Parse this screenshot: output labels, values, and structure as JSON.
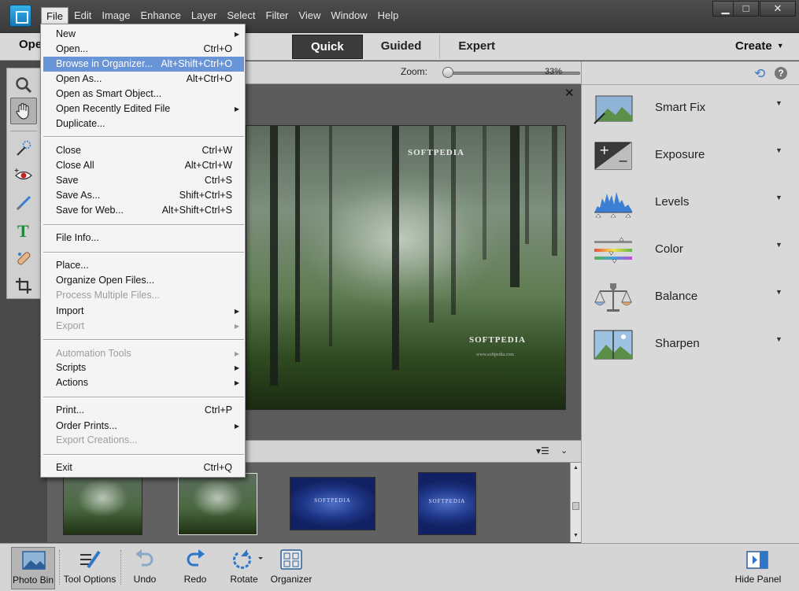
{
  "menubar": {
    "items": [
      "File",
      "Edit",
      "Image",
      "Enhance",
      "Layer",
      "Select",
      "Filter",
      "View",
      "Window",
      "Help"
    ]
  },
  "window_controls": {
    "minimize": "▁",
    "maximize": "□",
    "close": "✕"
  },
  "modebar": {
    "open_label": "Ope",
    "tabs": [
      "Quick",
      "Guided",
      "Expert"
    ],
    "active_tab": "Quick",
    "create_label": "Create"
  },
  "zoom": {
    "label": "Zoom:",
    "value": "33%",
    "level_percent": 33
  },
  "canvas": {
    "close_glyph": "✕",
    "photo_caption": "SOFTPEDIA",
    "photo_caption2": "SOFTPEDIA",
    "photo_subcaption": "www.softpedia.com"
  },
  "thumbnails": [
    {
      "kind": "forest",
      "caption": ""
    },
    {
      "kind": "forest",
      "caption": ""
    },
    {
      "kind": "blue",
      "caption": "SOFTPEDIA"
    },
    {
      "kind": "blue",
      "caption": "SOFTPEDIA"
    }
  ],
  "right_panel": {
    "adjustments": [
      {
        "label": "Smart Fix",
        "icon": "smart-fix-icon"
      },
      {
        "label": "Exposure",
        "icon": "exposure-icon"
      },
      {
        "label": "Levels",
        "icon": "levels-icon"
      },
      {
        "label": "Color",
        "icon": "color-icon"
      },
      {
        "label": "Balance",
        "icon": "balance-icon"
      },
      {
        "label": "Sharpen",
        "icon": "sharpen-icon"
      }
    ]
  },
  "bottombar": {
    "photo_bin": "Photo Bin",
    "tool_options": "Tool Options",
    "undo": "Undo",
    "redo": "Redo",
    "rotate": "Rotate",
    "organizer": "Organizer",
    "hide_panel": "Hide Panel"
  },
  "file_menu": {
    "items": [
      {
        "label": "New",
        "shortcut": "",
        "arrow": true,
        "disabled": false,
        "highlighted": false
      },
      {
        "label": "Open...",
        "shortcut": "Ctrl+O",
        "arrow": false,
        "disabled": false,
        "highlighted": false
      },
      {
        "label": "Browse in Organizer...",
        "shortcut": "Alt+Shift+Ctrl+O",
        "arrow": false,
        "disabled": false,
        "highlighted": true
      },
      {
        "label": "Open As...",
        "shortcut": "Alt+Ctrl+O",
        "arrow": false,
        "disabled": false,
        "highlighted": false
      },
      {
        "label": "Open as Smart Object...",
        "shortcut": "",
        "arrow": false,
        "disabled": false,
        "highlighted": false
      },
      {
        "label": "Open Recently Edited File",
        "shortcut": "",
        "arrow": true,
        "disabled": false,
        "highlighted": false
      },
      {
        "label": "Duplicate...",
        "shortcut": "",
        "arrow": false,
        "disabled": false,
        "highlighted": false
      },
      {
        "label": "Close",
        "shortcut": "Ctrl+W",
        "arrow": false,
        "disabled": false,
        "highlighted": false
      },
      {
        "label": "Close All",
        "shortcut": "Alt+Ctrl+W",
        "arrow": false,
        "disabled": false,
        "highlighted": false
      },
      {
        "label": "Save",
        "shortcut": "Ctrl+S",
        "arrow": false,
        "disabled": false,
        "highlighted": false
      },
      {
        "label": "Save As...",
        "shortcut": "Shift+Ctrl+S",
        "arrow": false,
        "disabled": false,
        "highlighted": false
      },
      {
        "label": "Save for Web...",
        "shortcut": "Alt+Shift+Ctrl+S",
        "arrow": false,
        "disabled": false,
        "highlighted": false
      },
      {
        "label": "File Info...",
        "shortcut": "",
        "arrow": false,
        "disabled": false,
        "highlighted": false
      },
      {
        "label": "Place...",
        "shortcut": "",
        "arrow": false,
        "disabled": false,
        "highlighted": false
      },
      {
        "label": "Organize Open Files...",
        "shortcut": "",
        "arrow": false,
        "disabled": false,
        "highlighted": false
      },
      {
        "label": "Process Multiple Files...",
        "shortcut": "",
        "arrow": false,
        "disabled": true,
        "highlighted": false
      },
      {
        "label": "Import",
        "shortcut": "",
        "arrow": true,
        "disabled": false,
        "highlighted": false
      },
      {
        "label": "Export",
        "shortcut": "",
        "arrow": true,
        "disabled": true,
        "highlighted": false
      },
      {
        "label": "Automation Tools",
        "shortcut": "",
        "arrow": true,
        "disabled": true,
        "highlighted": false
      },
      {
        "label": "Scripts",
        "shortcut": "",
        "arrow": true,
        "disabled": false,
        "highlighted": false
      },
      {
        "label": "Actions",
        "shortcut": "",
        "arrow": true,
        "disabled": false,
        "highlighted": false
      },
      {
        "label": "Print...",
        "shortcut": "Ctrl+P",
        "arrow": false,
        "disabled": false,
        "highlighted": false
      },
      {
        "label": "Order Prints...",
        "shortcut": "",
        "arrow": true,
        "disabled": false,
        "highlighted": false
      },
      {
        "label": "Export Creations...",
        "shortcut": "",
        "arrow": false,
        "disabled": true,
        "highlighted": false
      },
      {
        "label": "Exit",
        "shortcut": "Ctrl+Q",
        "arrow": false,
        "disabled": false,
        "highlighted": false
      }
    ]
  },
  "colors": {
    "menu_highlight": "#6994d6",
    "app_accent": "#1f8ed1"
  }
}
